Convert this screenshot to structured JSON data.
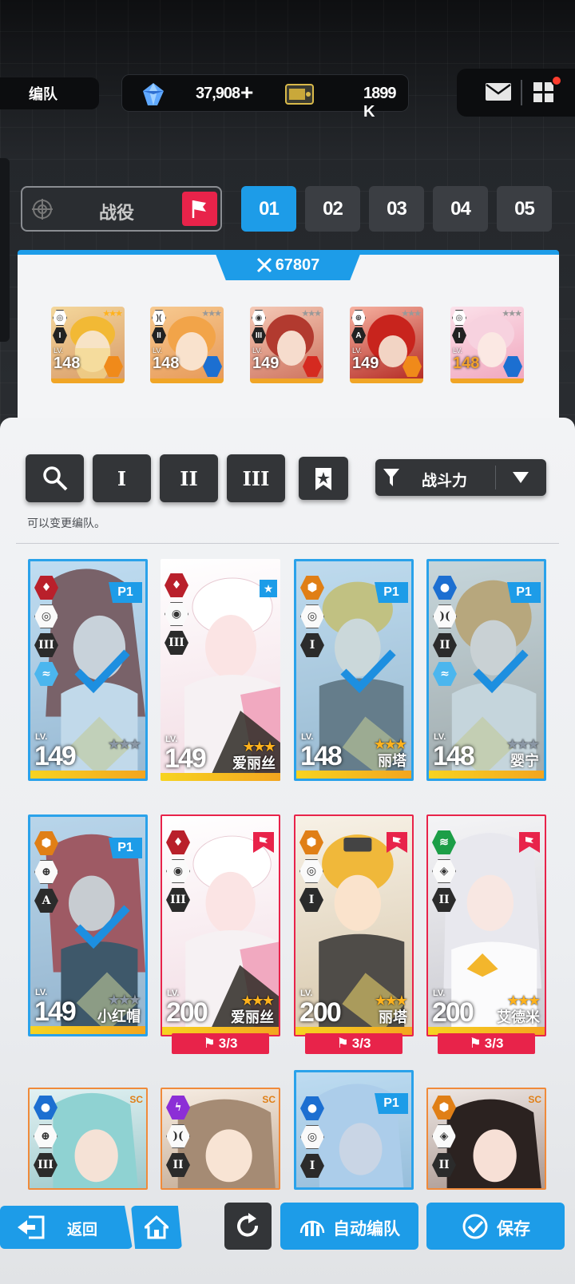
{
  "header": {
    "title": "编队",
    "gems": "37,908",
    "gems_plus": "+",
    "credits": "1899 K"
  },
  "mode": {
    "label": "战役"
  },
  "tabs": [
    {
      "label": "01",
      "active": true
    },
    {
      "label": "02",
      "active": false
    },
    {
      "label": "03",
      "active": false
    },
    {
      "label": "04",
      "active": false
    },
    {
      "label": "05",
      "active": false
    }
  ],
  "squad": {
    "power": "67807",
    "members": [
      {
        "lv_label": "LV.",
        "level": "148",
        "burst": "I",
        "element": "iron"
      },
      {
        "lv_label": "LV.",
        "level": "148",
        "burst": "II",
        "element": "water"
      },
      {
        "lv_label": "LV.",
        "level": "149",
        "burst": "III",
        "element": "fire"
      },
      {
        "lv_label": "LV.",
        "level": "149",
        "burst": "A",
        "element": "iron"
      },
      {
        "lv_label": "LV.",
        "level": "148",
        "burst": "I",
        "element": "water"
      }
    ]
  },
  "filters": {
    "burst1": "I",
    "burst2": "II",
    "burst3": "III",
    "sort_label": "战斗力",
    "hint": "可以变更编队。"
  },
  "cards": [
    {
      "lv_label": "LV.",
      "level": "149",
      "name": "",
      "flag": "P1",
      "burst": "III",
      "selected": true
    },
    {
      "lv_label": "LV.",
      "level": "149",
      "name": "爱丽丝",
      "flag": "",
      "burst": "III",
      "selected": false
    },
    {
      "lv_label": "LV.",
      "level": "148",
      "name": "丽塔",
      "flag": "P1",
      "burst": "I",
      "selected": true
    },
    {
      "lv_label": "LV.",
      "level": "148",
      "name": "婴宁",
      "flag": "P1",
      "burst": "II",
      "selected": true
    },
    {
      "lv_label": "LV.",
      "level": "149",
      "name": "小红帽",
      "flag": "P1",
      "burst": "A",
      "selected": true
    },
    {
      "lv_label": "LV.",
      "level": "200",
      "name": "爱丽丝",
      "flag": "",
      "burst": "III",
      "selected": false,
      "quota": "3/3"
    },
    {
      "lv_label": "LV.",
      "level": "200",
      "name": "丽塔",
      "flag": "",
      "burst": "I",
      "selected": false,
      "quota": "3/3"
    },
    {
      "lv_label": "LV.",
      "level": "200",
      "name": "艾德米",
      "flag": "",
      "burst": "II",
      "selected": false,
      "quota": "3/3"
    }
  ],
  "row3": [
    {
      "burst": "III",
      "flag": "SC"
    },
    {
      "burst": "II",
      "flag": "SC"
    },
    {
      "burst": "I",
      "flag": "P1"
    },
    {
      "burst": "II",
      "flag": "SC"
    }
  ],
  "bottom": {
    "back": "返回",
    "auto": "自动编队",
    "save": "保存"
  },
  "colors": {
    "accent": "#1d9ce8",
    "red": "#e8234a",
    "gold": "#f0a526"
  }
}
